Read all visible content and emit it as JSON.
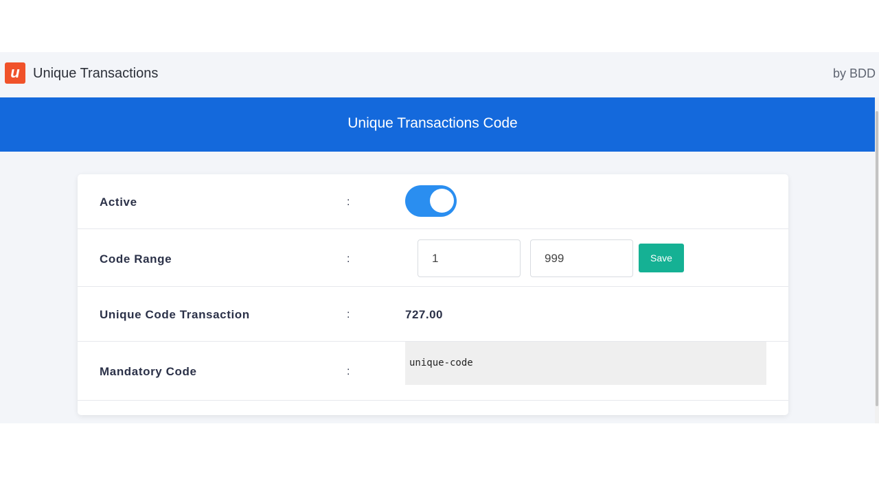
{
  "app": {
    "logo_letter": "u",
    "title": "Unique Transactions",
    "by_label": "by BDD",
    "accent_color": "#1469dc",
    "logo_color": "#f0522a"
  },
  "banner": {
    "title": "Unique Transactions Code"
  },
  "settings": {
    "colon": ":",
    "active": {
      "label": "Active",
      "value": true
    },
    "code_range": {
      "label": "Code Range",
      "min_value": "1",
      "max_value": "999",
      "save_label": "Save"
    },
    "unique_code_transaction": {
      "label": "Unique Code Transaction",
      "value": "727.00"
    },
    "mandatory_code": {
      "label": "Mandatory Code",
      "value": "unique-code"
    }
  }
}
